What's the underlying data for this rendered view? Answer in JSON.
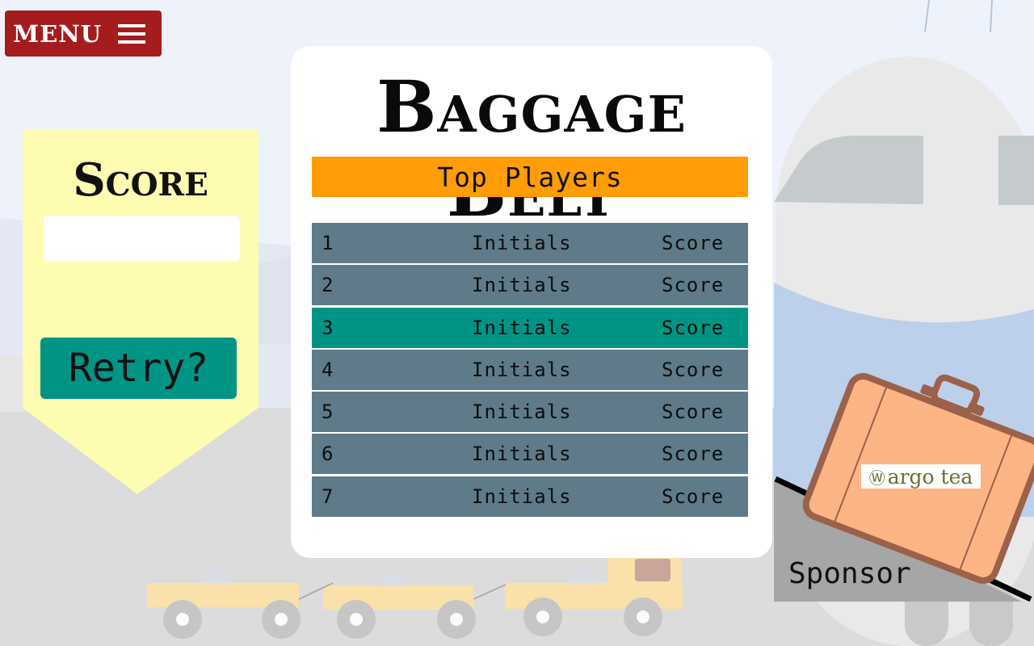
{
  "header": {
    "menu_label": "MENU",
    "menu_icon": "hamburger-icon"
  },
  "game": {
    "title": "Baggage Belt"
  },
  "score_panel": {
    "title": "Score",
    "score_value": "",
    "retry_label": "Retry?"
  },
  "leaderboard": {
    "title": "Top Players",
    "highlighted_rank": 3,
    "rows": [
      {
        "rank": "1",
        "initials": "Initials",
        "score": "Score"
      },
      {
        "rank": "2",
        "initials": "Initials",
        "score": "Score"
      },
      {
        "rank": "3",
        "initials": "Initials",
        "score": "Score"
      },
      {
        "rank": "4",
        "initials": "Initials",
        "score": "Score"
      },
      {
        "rank": "5",
        "initials": "Initials",
        "score": "Score"
      },
      {
        "rank": "6",
        "initials": "Initials",
        "score": "Score"
      },
      {
        "rank": "7",
        "initials": "Initials",
        "score": "Score"
      }
    ]
  },
  "sponsor": {
    "label": "Sponsor",
    "logo_text": "argo tea",
    "logo_icon": "leaf-circle-icon"
  },
  "colors": {
    "menu_bg": "#a51c1e",
    "panel_yellow": "#fefcb0",
    "accent_teal": "#009485",
    "header_orange": "#ff9c06",
    "row_slate": "#5f7b89",
    "suitcase": "#fcb485"
  }
}
